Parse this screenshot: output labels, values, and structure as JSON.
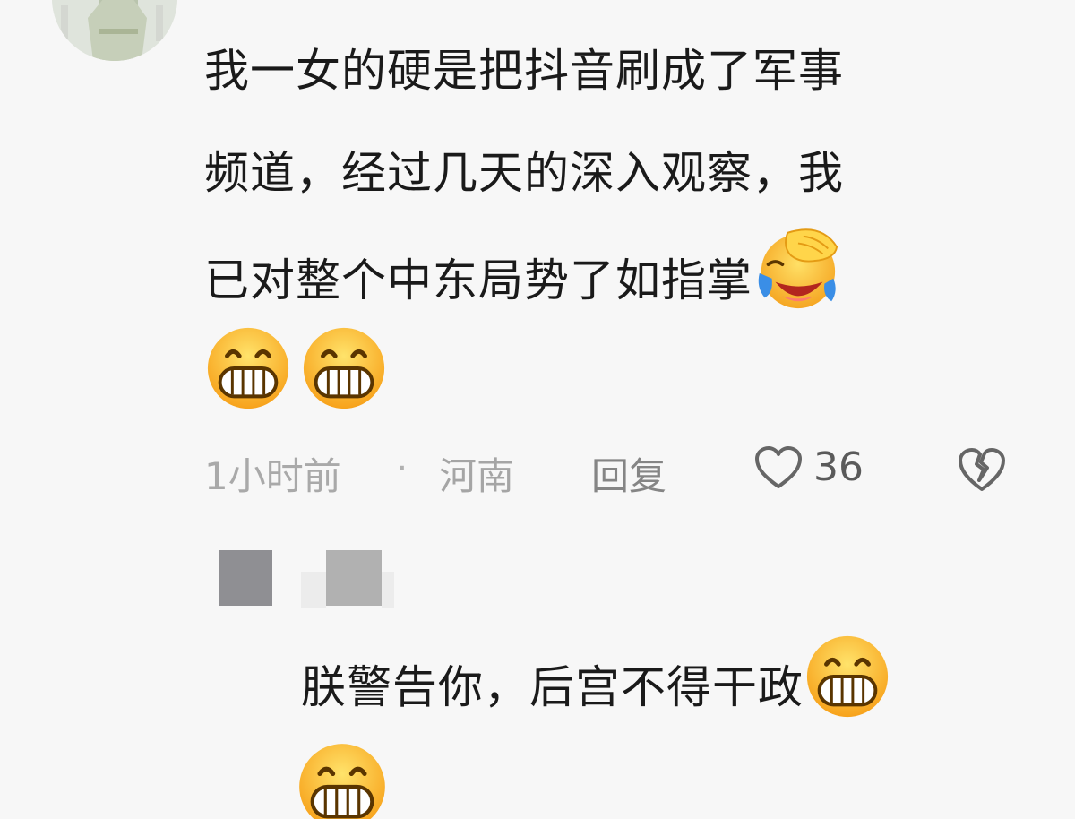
{
  "comment": {
    "lines": [
      "我一女的硬是把抖音刷成了军事",
      "频道，经过几天的深入观察，我",
      "已对整个中东局势了如指掌"
    ],
    "inline_emoji": "facepalm-laugh-emoji",
    "trailing_emojis": [
      "grin-emoji",
      "grin-emoji"
    ],
    "time": "1小时前",
    "separator": "·",
    "location": "河南",
    "reply_label": "回复",
    "likes": "36"
  },
  "reply": {
    "user_name_pixelated": true,
    "text": "朕警告你，后宫不得干政",
    "inline_emoji": "grin-emoji",
    "trailing_emojis": [
      "grin-emoji"
    ]
  },
  "colors": {
    "background": "#f7f7f7",
    "text": "#1a1a1a",
    "meta": "#a9a9a9",
    "emoji_yellow": "#ffcf3a",
    "emoji_orange": "#f7a21b"
  }
}
